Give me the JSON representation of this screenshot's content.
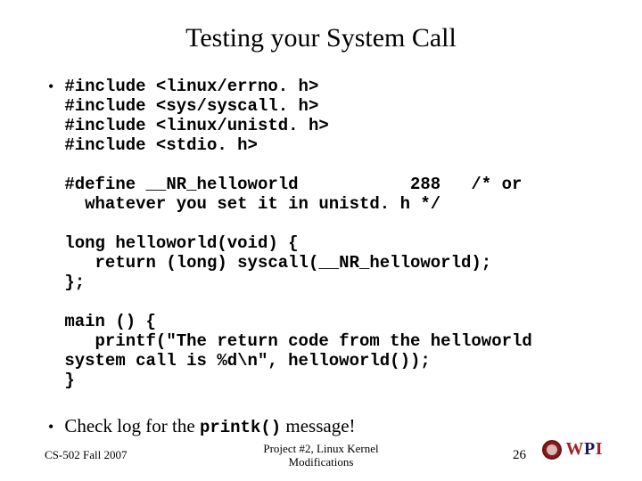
{
  "title": "Testing your System Call",
  "code": {
    "includes": "#include <linux/errno. h>\n#include <sys/syscall. h>\n#include <linux/unistd. h>\n#include <stdio. h>",
    "define": "#define __NR_helloworld           288   /* or\n  whatever you set it in unistd. h */",
    "func": "long helloworld(void) {\n   return (long) syscall(__NR_helloworld);\n};",
    "main": "main () {\n   printf(\"The return code from the helloworld\nsystem call is %d\\n\", helloworld());\n}"
  },
  "check": {
    "prefix": "Check log for the ",
    "code": "printk()",
    "suffix": " message!"
  },
  "footer": {
    "left": "CS-502 Fall 2007",
    "center_line1": "Project #2, Linux Kernel",
    "center_line2": "Modifications",
    "page": "26",
    "logo_w": "W",
    "logo_p": "P",
    "logo_i": "I"
  }
}
